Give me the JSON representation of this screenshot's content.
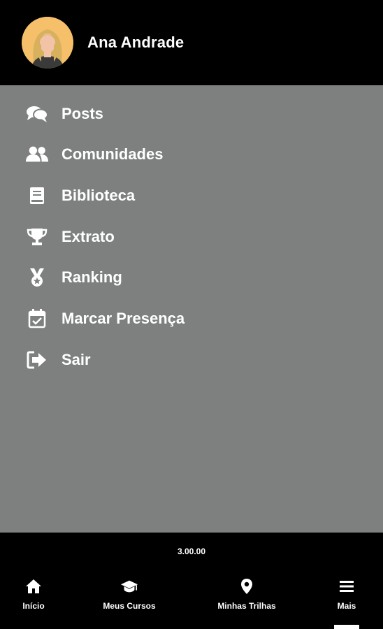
{
  "header": {
    "user_name": "Ana Andrade",
    "avatar_icon": "user-avatar-woman"
  },
  "menu": {
    "items": [
      {
        "label": "Posts",
        "icon": "comments-icon"
      },
      {
        "label": "Comunidades",
        "icon": "users-icon"
      },
      {
        "label": "Biblioteca",
        "icon": "book-icon"
      },
      {
        "label": "Extrato",
        "icon": "trophy-icon"
      },
      {
        "label": "Ranking",
        "icon": "medal-icon"
      },
      {
        "label": "Marcar Presença",
        "icon": "calendar-check-icon"
      },
      {
        "label": "Sair",
        "icon": "sign-out-icon"
      }
    ]
  },
  "footer": {
    "version": "3.00.00",
    "nav": [
      {
        "label": "Início",
        "icon": "home-icon"
      },
      {
        "label": "Meus Cursos",
        "icon": "graduation-cap-icon"
      },
      {
        "label": "Minhas Trilhas",
        "icon": "map-marker-icon"
      },
      {
        "label": "Mais",
        "icon": "menu-bars-icon",
        "active": true
      }
    ]
  },
  "colors": {
    "header_bg": "#000000",
    "menu_bg": "#7e8080",
    "text": "#ffffff",
    "avatar_bg": "#f6c06a"
  }
}
